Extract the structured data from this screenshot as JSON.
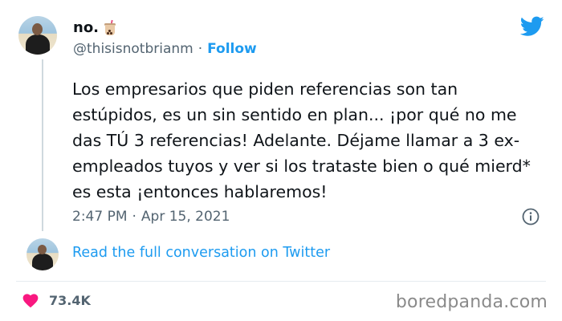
{
  "author": {
    "display_name": "no.",
    "emoji_icon": "bubble-tea-icon",
    "handle": "@thisisnotbrianm",
    "separator": "·",
    "follow_label": "Follow"
  },
  "tweet": {
    "text": "Los empresarios que piden referencias son tan estúpidos, es un sin sentido en plan... ¡por qué no me das TÚ 3 referencias! Adelante. Déjame llamar a 3 ex-empleados tuyos y ver si los trataste bien o qué mierd* es esta ¡entonces hablaremos!",
    "time": "2:47 PM",
    "separator": "·",
    "date": "Apr 15, 2021"
  },
  "conversation_link": "Read the full conversation on Twitter",
  "likes": {
    "count": "73.4K",
    "heart_color": "#f91880"
  },
  "watermark": "boredpanda.com",
  "colors": {
    "accent": "#1d9bf0",
    "muted": "#536471",
    "text": "#0f1419"
  }
}
